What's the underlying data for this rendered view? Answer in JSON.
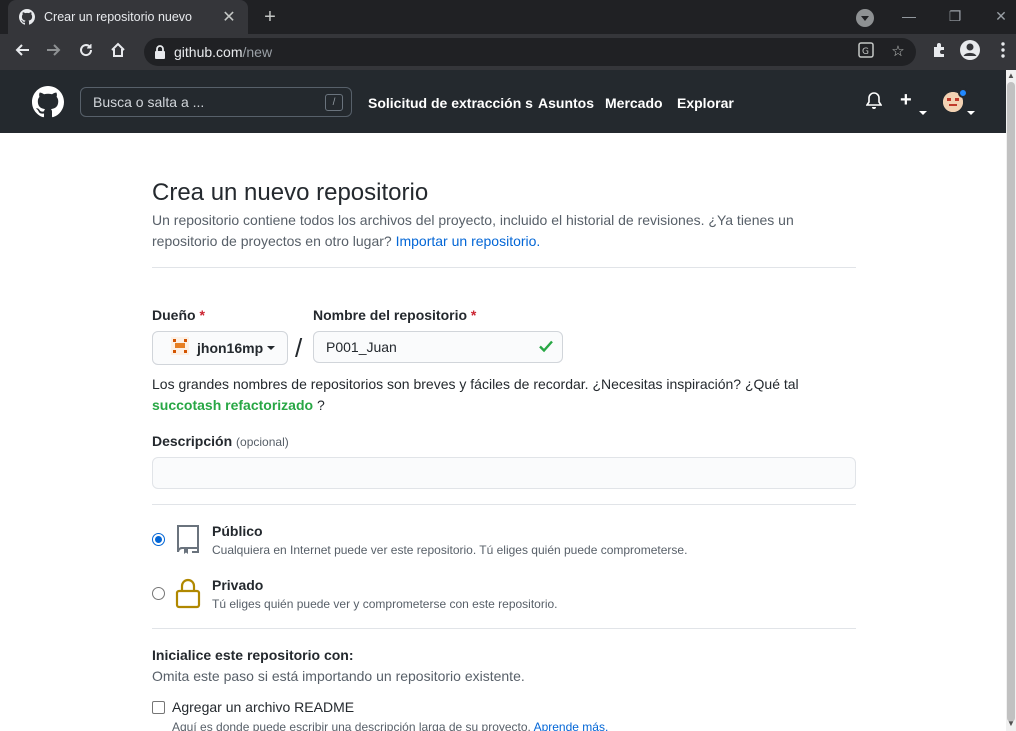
{
  "browser": {
    "tab_title": "Crear un repositorio nuevo",
    "tab_close": "✕",
    "new_tab": "+",
    "url_domain": "github.com",
    "url_path": "/new",
    "win_min": "—",
    "win_restore": "❐",
    "win_close": "✕"
  },
  "header": {
    "search_placeholder": "Busca o salta a ...",
    "search_key": "/",
    "nav": [
      "Solicitud de extracción s",
      "Asuntos",
      "Mercado",
      "Explorar"
    ],
    "plus": "+"
  },
  "page": {
    "title": "Crea un nuevo repositorio",
    "subtitle": "Un repositorio contiene todos los archivos del proyecto, incluido el historial de revisiones. ¿Ya tienes un repositorio de proyectos en otro lugar?",
    "import_link": "Importar un repositorio.",
    "owner_label": "Dueño",
    "owner_value": "jhon16mp",
    "required_mark": "*",
    "repo_label": "Nombre del repositorio",
    "repo_value": "P001_Juan",
    "separator": "/",
    "hint_text": "Los grandes nombres de repositorios son breves y fáciles de recordar. ¿Necesitas inspiración? ¿Qué tal",
    "hint_suggestion": "succotash refactorizado",
    "hint_end": "?",
    "desc_label": "Descripción",
    "desc_optional": "(opcional)",
    "desc_value": "",
    "visibility": [
      {
        "title": "Público",
        "desc": "Cualquiera en Internet puede ver este repositorio. Tú eliges quién puede comprometerse.",
        "selected": true
      },
      {
        "title": "Privado",
        "desc": "Tú eliges quién puede ver y comprometerse con este repositorio.",
        "selected": false
      }
    ],
    "init_title": "Inicialice este repositorio con:",
    "init_sub": "Omita este paso si está importando un repositorio existente.",
    "readme_label": "Agregar un archivo README",
    "readme_desc": "Aquí es donde puede escribir una descripción larga de su proyecto.",
    "readme_link": "Aprende más."
  },
  "colors": {
    "header_bg": "#24292e",
    "link": "#0366d6",
    "success": "#28a745",
    "required": "#cb2431",
    "lock_icon": "#b08800"
  }
}
